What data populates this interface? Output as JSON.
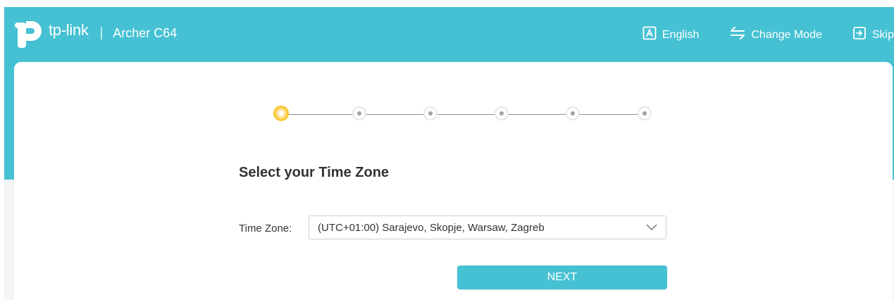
{
  "header": {
    "brand": "tp-link",
    "divider": "|",
    "model": "Archer C64",
    "actions": {
      "language_label": "English",
      "change_mode_label": "Change Mode",
      "skip_label": "Skip"
    },
    "icons": {
      "logo": "tp-link-logo-icon",
      "language": "language-a-icon",
      "change_mode": "swap-arrows-icon",
      "skip": "skip-exit-icon"
    }
  },
  "stepper": {
    "total_steps": 6,
    "current_step": 1
  },
  "main": {
    "title": "Select your Time Zone",
    "timezone": {
      "label": "Time Zone:",
      "selected": "(UTC+01:00) Sarajevo, Skopje, Warsaw, Zagreb"
    },
    "next_label": "NEXT"
  },
  "colors": {
    "brand_teal": "#45c1d3",
    "active_step": "#fbc52d",
    "button": "#46c1d4",
    "text": "#333333"
  }
}
